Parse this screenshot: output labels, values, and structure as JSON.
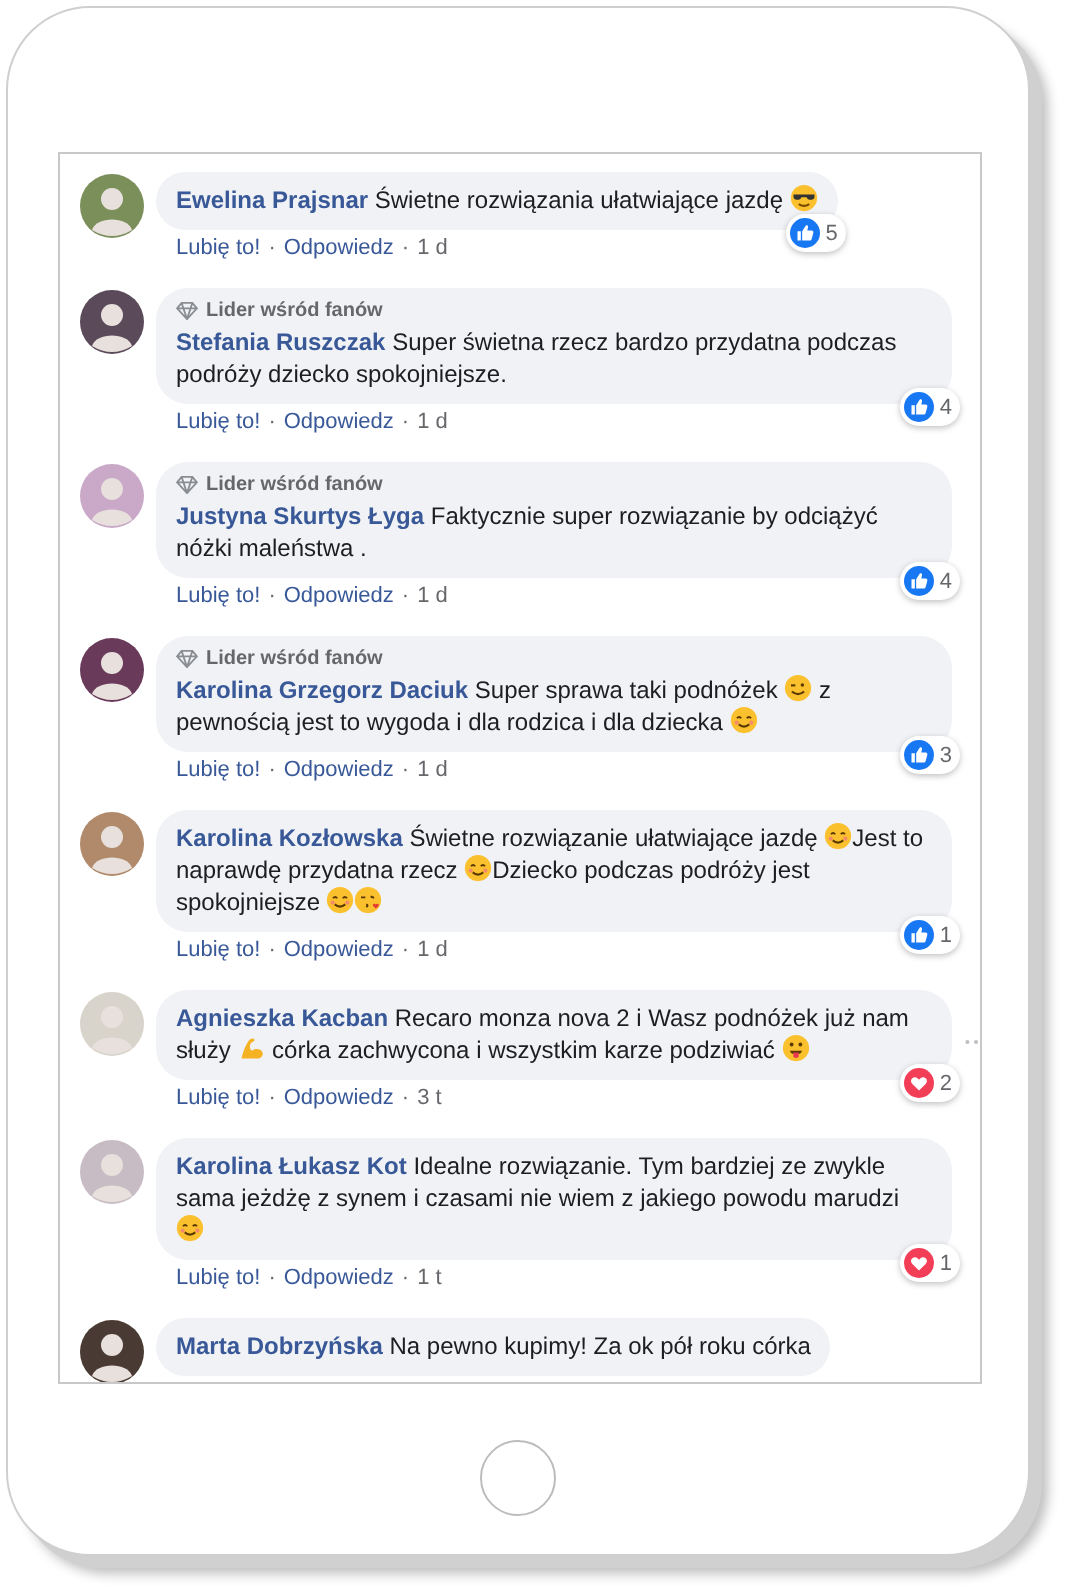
{
  "separator": "·",
  "comments": [
    {
      "author": "Ewelina Prajsnar",
      "body": [
        {
          "kind": "text",
          "text": "Świetne rozwiązania ułatwiające jazdę "
        },
        {
          "kind": "cool"
        }
      ],
      "reaction": {
        "kind": "like",
        "count": "5"
      },
      "like": "Lubię to!",
      "reply": "Odpowiedz",
      "time": "1 d",
      "menu_shown": false
    },
    {
      "author": "Stefania Ruszczak",
      "fan_badge": "Lider wśród fanów",
      "body": [
        {
          "kind": "text",
          "text": "Super świetna rzecz bardzo przydatna podczas podróży dziecko spokojniejsze."
        }
      ],
      "reaction": {
        "kind": "like",
        "count": "4"
      },
      "like": "Lubię to!",
      "reply": "Odpowiedz",
      "time": "1 d",
      "menu_shown": false
    },
    {
      "author": "Justyna Skurtys Łyga",
      "fan_badge": "Lider wśród fanów",
      "body": [
        {
          "kind": "text",
          "text": "Faktycznie super rozwiązanie by odciążyć nóżki maleństwa ."
        }
      ],
      "reaction": {
        "kind": "like",
        "count": "4"
      },
      "like": "Lubię to!",
      "reply": "Odpowiedz",
      "time": "1 d",
      "menu_shown": false
    },
    {
      "author": "Karolina Grzegorz Daciuk",
      "fan_badge": "Lider wśród fanów",
      "body": [
        {
          "kind": "text",
          "text": "Super sprawa taki podnóżek "
        },
        {
          "kind": "wink"
        },
        {
          "kind": "text",
          "text": " z pewnością jest to wygoda i dla rodzica i dla dziecka "
        },
        {
          "kind": "smile"
        }
      ],
      "reaction": {
        "kind": "like",
        "count": "3"
      },
      "like": "Lubię to!",
      "reply": "Odpowiedz",
      "time": "1 d",
      "menu_shown": false
    },
    {
      "author": "Karolina Kozłowska",
      "body": [
        {
          "kind": "text",
          "text": "Świetne rozwiązanie ułatwiające jazdę "
        },
        {
          "kind": "smile"
        },
        {
          "kind": "text",
          "text": "Jest to naprawdę przydatna rzecz "
        },
        {
          "kind": "smile"
        },
        {
          "kind": "text",
          "text": "Dziecko podczas podróży jest spokojniejsze "
        },
        {
          "kind": "smile"
        },
        {
          "kind": "kiss"
        }
      ],
      "reaction": {
        "kind": "like",
        "count": "1"
      },
      "like": "Lubię to!",
      "reply": "Odpowiedz",
      "time": "1 d",
      "menu_shown": false
    },
    {
      "author": "Agnieszka Kacban",
      "body": [
        {
          "kind": "text",
          "text": "Recaro monza nova 2 i Wasz podnóżek już nam służy "
        },
        {
          "kind": "muscle"
        },
        {
          "kind": "text",
          "text": " córka zachwycona i wszystkim karze podziwiać "
        },
        {
          "kind": "tongue"
        }
      ],
      "reaction": {
        "kind": "love",
        "count": "2"
      },
      "like": "Lubię to!",
      "reply": "Odpowiedz",
      "time": "3 t",
      "menu_shown": true
    },
    {
      "author": "Karolina Łukasz Kot",
      "body": [
        {
          "kind": "text",
          "text": "Idealne rozwiązanie. Tym bardziej ze zwykle sama jeżdżę z synem i czasami nie wiem z jakiego powodu marudzi "
        },
        {
          "kind": "smile"
        }
      ],
      "reaction": {
        "kind": "love",
        "count": "1"
      },
      "like": "Lubię to!",
      "reply": "Odpowiedz",
      "time": "1 t",
      "menu_shown": false
    },
    {
      "author": "Marta Dobrzyńska",
      "body": [
        {
          "kind": "text",
          "text": "Na pewno kupimy! Za ok pół roku córka"
        }
      ],
      "menu_shown": false
    }
  ]
}
